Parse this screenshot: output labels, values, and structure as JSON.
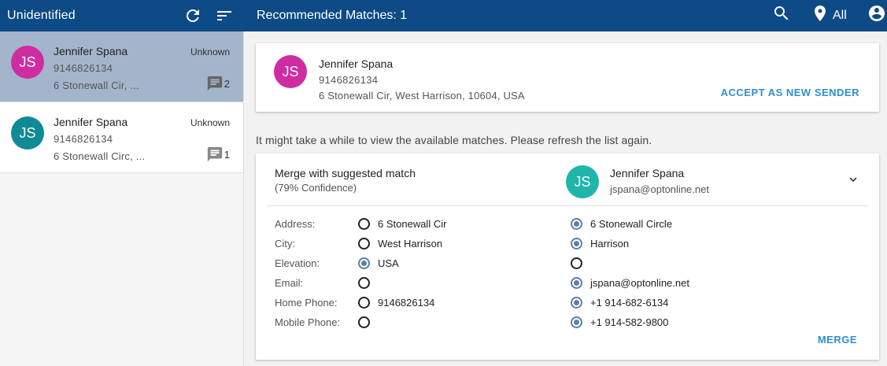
{
  "colors": {
    "header_bg": "#0d4a86",
    "selected_row_bg": "#a4b5cb",
    "accent": "#2f8fd0",
    "radio_checked": "#5b7fa9",
    "avatar_magenta": "#d02ca2",
    "avatar_teal_dark": "#0e8b95",
    "avatar_teal_light": "#1fb5aa"
  },
  "left_header": {
    "title": "Unidentified",
    "icons": [
      "refresh-icon",
      "sort-icon"
    ]
  },
  "right_header": {
    "title": "Recommended Matches: 1",
    "filter_label": "All",
    "icons": [
      "search-icon",
      "location-pin-icon",
      "account-circle-icon"
    ]
  },
  "contacts": [
    {
      "initials": "JS",
      "name": "Jennifer Spana",
      "phone": "9146826134",
      "address": "6 Stonewall Cir, ...",
      "status": "Unknown",
      "message_count": "2",
      "selected": true
    },
    {
      "initials": "JS",
      "name": "Jennifer Spana",
      "phone": "9146826134",
      "address": "6 Stonewall Circ, ...",
      "status": "Unknown",
      "message_count": "1",
      "selected": false
    }
  ],
  "sender_card": {
    "initials": "JS",
    "name": "Jennifer Spana",
    "phone": "9146826134",
    "address": "6 Stonewall Cir, West Harrison, 10604, USA",
    "accept_label": "ACCEPT AS NEW SENDER"
  },
  "hint_text": "It might take a while to view the available matches. Please refresh the list again.",
  "match_card": {
    "title": "Merge with suggested match",
    "confidence": "(79% Confidence)",
    "match_initials": "JS",
    "match_name": "Jennifer Spana",
    "match_email": "jspana@optonline.net",
    "merge_label": "MERGE",
    "fields": [
      {
        "label": "Address:",
        "left": "6 Stonewall Cir",
        "right": "6 Stonewall Circle",
        "selected": "right"
      },
      {
        "label": "City:",
        "left": "West Harrison",
        "right": "Harrison",
        "selected": "right"
      },
      {
        "label": "Elevation:",
        "left": "USA",
        "right": "",
        "selected": "left"
      },
      {
        "label": "Email:",
        "left": "",
        "right": "jspana@optonline.net",
        "selected": "right"
      },
      {
        "label": "Home Phone:",
        "left": "9146826134",
        "right": "+1 914-682-6134",
        "selected": "right"
      },
      {
        "label": "Mobile Phone:",
        "left": "",
        "right": "+1 914-582-9800",
        "selected": "right"
      }
    ]
  }
}
